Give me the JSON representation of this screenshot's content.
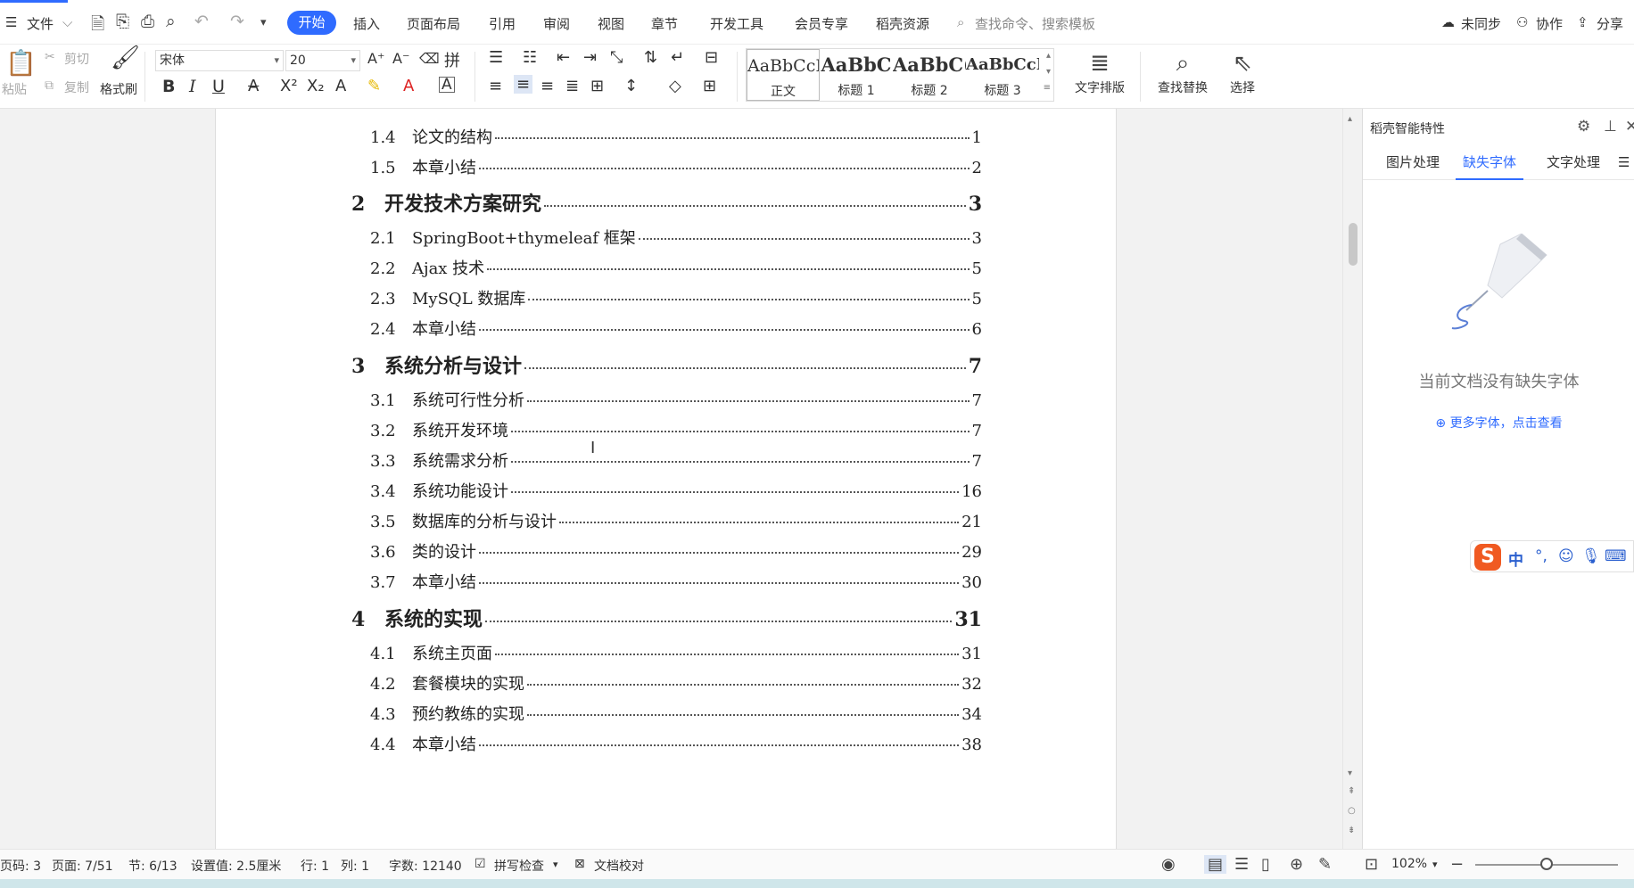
{
  "menubar": {
    "file": "文件",
    "tabs": [
      "开始",
      "插入",
      "页面布局",
      "引用",
      "审阅",
      "视图",
      "章节",
      "开发工具",
      "会员专享",
      "稻壳资源"
    ],
    "active_tab": "开始",
    "search_placeholder": "查找命令、搜索模板",
    "sync": "未同步",
    "collab": "协作",
    "share": "分享"
  },
  "ribbon": {
    "paste": "粘贴",
    "cut": "剪切",
    "copy": "复制",
    "format_painter": "格式刷",
    "font": "宋体",
    "size": "20",
    "styles": [
      {
        "sample": "AaBbCcI",
        "label": "正文"
      },
      {
        "sample": "AaBbC",
        "label": "标题 1"
      },
      {
        "sample": "AaBbC(",
        "label": "标题 2"
      },
      {
        "sample": "AaBbCcI",
        "label": "标题 3"
      }
    ],
    "text_layout": "文字排版",
    "find_replace": "查找替换",
    "select": "选择"
  },
  "toc": [
    {
      "level": 2,
      "num": "1.4",
      "title": "论文的结构",
      "page": "1"
    },
    {
      "level": 2,
      "num": "1.5",
      "title": "本章小结",
      "page": "2"
    },
    {
      "level": 1,
      "num": "2",
      "title": "开发技术方案研究",
      "page": "3"
    },
    {
      "level": 2,
      "num": "2.1",
      "title": "SpringBoot+thymeleaf 框架",
      "page": "3"
    },
    {
      "level": 2,
      "num": "2.2",
      "title": "Ajax 技术",
      "page": "5"
    },
    {
      "level": 2,
      "num": "2.3",
      "title": "MySQL 数据库",
      "page": "5"
    },
    {
      "level": 2,
      "num": "2.4",
      "title": "本章小结",
      "page": "6"
    },
    {
      "level": 1,
      "num": "3",
      "title": "系统分析与设计",
      "page": "7"
    },
    {
      "level": 2,
      "num": "3.1",
      "title": "系统可行性分析",
      "page": "7"
    },
    {
      "level": 2,
      "num": "3.2",
      "title": "系统开发环境",
      "page": "7"
    },
    {
      "level": 2,
      "num": "3.3",
      "title": "系统需求分析",
      "page": "7"
    },
    {
      "level": 2,
      "num": "3.4",
      "title": "系统功能设计",
      "page": "16"
    },
    {
      "level": 2,
      "num": "3.5",
      "title": "数据库的分析与设计",
      "page": "21"
    },
    {
      "level": 2,
      "num": "3.6",
      "title": "类的设计",
      "page": "29"
    },
    {
      "level": 2,
      "num": "3.7",
      "title": "本章小结",
      "page": "30"
    },
    {
      "level": 1,
      "num": "4",
      "title": "系统的实现",
      "page": "31"
    },
    {
      "level": 2,
      "num": "4.1",
      "title": "系统主页面",
      "page": "31"
    },
    {
      "level": 2,
      "num": "4.2",
      "title": "套餐模块的实现",
      "page": "32"
    },
    {
      "level": 2,
      "num": "4.3",
      "title": "预约教练的实现",
      "page": "34"
    },
    {
      "level": 2,
      "num": "4.4",
      "title": "本章小结",
      "page": "38"
    }
  ],
  "panel": {
    "title": "稻壳智能特性",
    "tabs": [
      "图片处理",
      "缺失字体",
      "文字处理"
    ],
    "active_tab": "缺失字体",
    "empty_message": "当前文档没有缺失字体",
    "more_link": "更多字体，点击查看"
  },
  "ime": {
    "logo": "S",
    "mode": "中"
  },
  "status": {
    "page_code": "页码: 3",
    "page": "页面: 7/51",
    "section": "节: 6/13",
    "setting": "设置值: 2.5厘米",
    "row": "行: 1",
    "col": "列: 1",
    "word_count": "字数: 12140",
    "spell_check": "拼写检查",
    "doc_proof": "文档校对",
    "zoom": "102%",
    "zoom_level": 0.51
  }
}
